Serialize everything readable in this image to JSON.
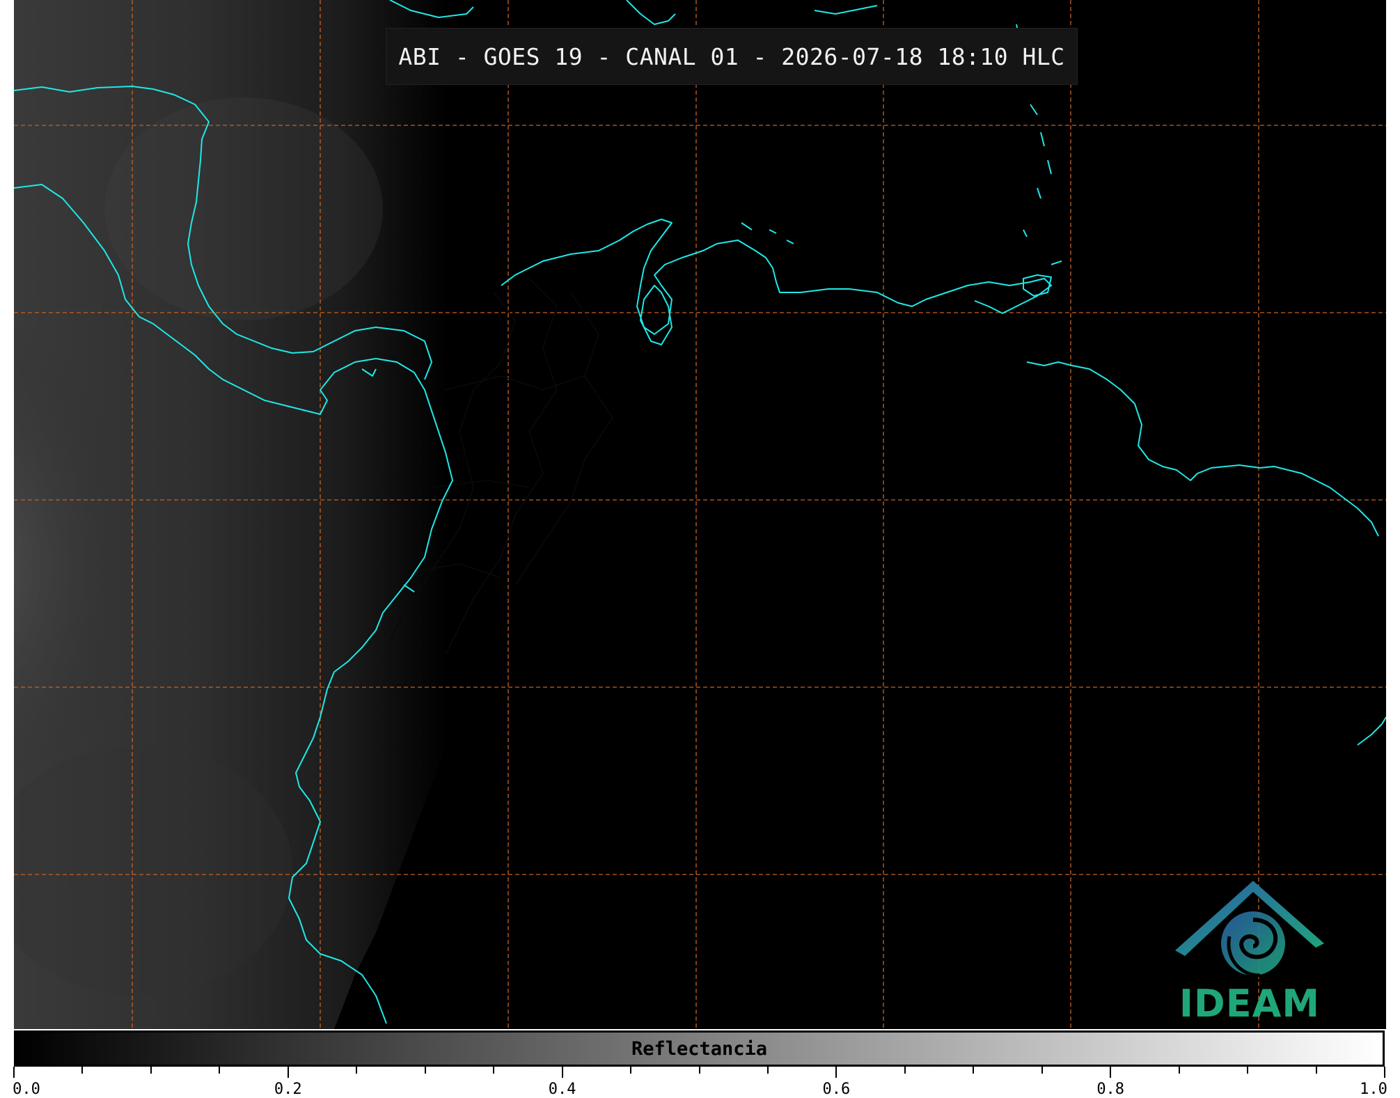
{
  "title": "ABI - GOES 19 - CANAL 01 - 2026-07-18 18:10 HLC",
  "logo": {
    "name": "IDEAM",
    "icon": "ideam-logo-icon"
  },
  "colorbar": {
    "label": "Reflectancia",
    "min": 0.0,
    "max": 1.0,
    "colors": [
      "#000000",
      "#ffffff"
    ],
    "major_ticks": [
      "0.0",
      "0.2",
      "0.4",
      "0.6",
      "0.8",
      "1.0"
    ],
    "minor_tick_step": 0.05
  },
  "map": {
    "grid_color": "#c8621e",
    "coastline_color": "#1fe8e8",
    "border_color": "#0a0a0a",
    "background": "#000000"
  }
}
